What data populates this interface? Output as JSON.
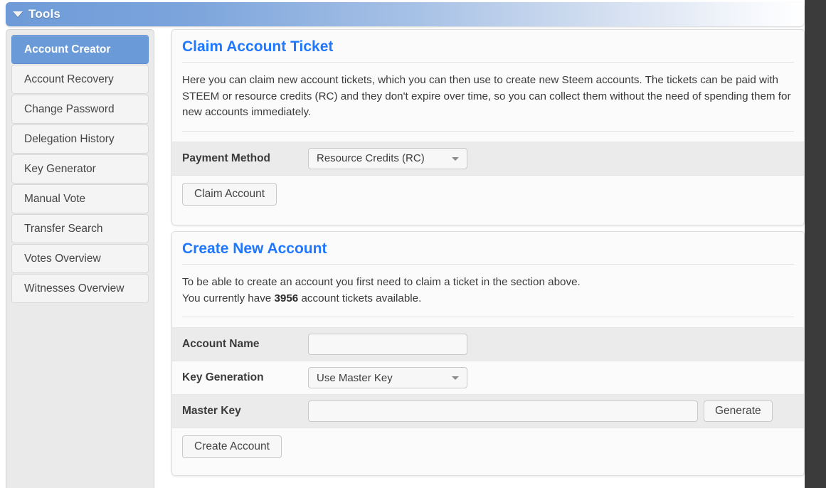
{
  "window": {
    "header": {
      "title": "Tools",
      "caret_icon": "chevron-down-icon",
      "gradient_from": "#6e9bd8",
      "gradient_to": "#ffffff"
    },
    "gutter_color": "#3b3b3b"
  },
  "sidebar": {
    "active_color": "#6a9bd8",
    "items": [
      {
        "label": "Account Creator",
        "active": true
      },
      {
        "label": "Account Recovery",
        "active": false
      },
      {
        "label": "Change Password",
        "active": false
      },
      {
        "label": "Delegation History",
        "active": false
      },
      {
        "label": "Key Generator",
        "active": false
      },
      {
        "label": "Manual Vote",
        "active": false
      },
      {
        "label": "Transfer Search",
        "active": false
      },
      {
        "label": "Votes Overview",
        "active": false
      },
      {
        "label": "Witnesses Overview",
        "active": false
      }
    ]
  },
  "panels": {
    "title_color": "#1f78ff",
    "claim": {
      "title": "Claim Account Ticket",
      "description": "Here you can claim new account tickets, which you can then use to create new Steem accounts. The tickets can be paid with STEEM or resource credits (RC) and they don't expire over time, so you can collect them without the need of spending them for new accounts immediately.",
      "payment_method": {
        "label": "Payment Method",
        "selected": "Resource Credits (RC)",
        "caret_icon": "chevron-down-icon"
      },
      "claim_button": "Claim Account"
    },
    "create": {
      "title": "Create New Account",
      "description_line1": "To be able to create an account you first need to claim a ticket in the section above.",
      "description_line2_before": "You currently have ",
      "ticket_count": "3956",
      "description_line2_after": " account tickets available.",
      "account_name": {
        "label": "Account Name",
        "value": "",
        "placeholder": ""
      },
      "key_generation": {
        "label": "Key Generation",
        "selected": "Use Master Key",
        "caret_icon": "chevron-down-icon"
      },
      "master_key": {
        "label": "Master Key",
        "value": "",
        "placeholder": "",
        "generate_button": "Generate"
      },
      "create_button": "Create Account"
    }
  }
}
